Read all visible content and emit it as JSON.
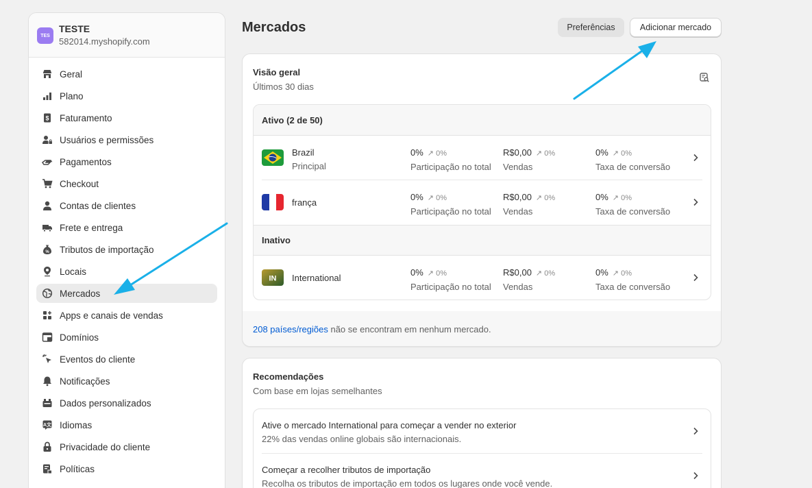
{
  "store": {
    "avatar": "TES",
    "name": "TESTE",
    "url": "582014.myshopify.com"
  },
  "sidebar": {
    "items": [
      {
        "label": "Geral",
        "icon": "store-icon"
      },
      {
        "label": "Plano",
        "icon": "plan-icon"
      },
      {
        "label": "Faturamento",
        "icon": "billing-icon"
      },
      {
        "label": "Usuários e permissões",
        "icon": "users-icon"
      },
      {
        "label": "Pagamentos",
        "icon": "payments-icon"
      },
      {
        "label": "Checkout",
        "icon": "cart-icon"
      },
      {
        "label": "Contas de clientes",
        "icon": "person-icon"
      },
      {
        "label": "Frete e entrega",
        "icon": "truck-icon"
      },
      {
        "label": "Tributos de importação",
        "icon": "duties-icon"
      },
      {
        "label": "Locais",
        "icon": "location-icon"
      },
      {
        "label": "Mercados",
        "icon": "globe-icon",
        "active": true
      },
      {
        "label": "Apps e canais de vendas",
        "icon": "apps-icon"
      },
      {
        "label": "Domínios",
        "icon": "domain-icon"
      },
      {
        "label": "Eventos do cliente",
        "icon": "cursor-icon"
      },
      {
        "label": "Notificações",
        "icon": "bell-icon"
      },
      {
        "label": "Dados personalizados",
        "icon": "data-icon"
      },
      {
        "label": "Idiomas",
        "icon": "language-icon"
      },
      {
        "label": "Privacidade do cliente",
        "icon": "lock-icon"
      },
      {
        "label": "Políticas",
        "icon": "policy-icon"
      }
    ]
  },
  "header": {
    "title": "Mercados",
    "preferences_label": "Preferências",
    "add_market_label": "Adicionar mercado"
  },
  "overview": {
    "title": "Visão geral",
    "subtitle": "Últimos 30 dias",
    "active_heading": "Ativo (2 de 50)",
    "inactive_heading": "Inativo",
    "markets": [
      {
        "name": "Brazil",
        "sub": "Principal",
        "flag": "brazil-flag-icon",
        "share": "0%",
        "share_delta": "0%",
        "share_label": "Participação no total",
        "sales": "R$0,00",
        "sales_delta": "0%",
        "sales_label": "Vendas",
        "conv": "0%",
        "conv_delta": "0%",
        "conv_label": "Taxa de conversão"
      },
      {
        "name": "frança",
        "sub": "",
        "flag": "france-flag-icon",
        "share": "0%",
        "share_delta": "0%",
        "share_label": "Participação no total",
        "sales": "R$0,00",
        "sales_delta": "0%",
        "sales_label": "Vendas",
        "conv": "0%",
        "conv_delta": "0%",
        "conv_label": "Taxa de conversão"
      },
      {
        "name": "International",
        "sub": "",
        "flag": "international-badge-icon",
        "badge": "IN",
        "share": "0%",
        "share_delta": "0%",
        "share_label": "Participação no total",
        "sales": "R$0,00",
        "sales_delta": "0%",
        "sales_label": "Vendas",
        "conv": "0%",
        "conv_delta": "0%",
        "conv_label": "Taxa de conversão"
      }
    ],
    "footer_link": "208 países/regiões",
    "footer_text": " não se encontram em nenhum mercado."
  },
  "recommendations": {
    "title": "Recomendações",
    "subtitle": "Com base em lojas semelhantes",
    "items": [
      {
        "title": "Ative o mercado International para começar a vender no exterior",
        "desc": "22% das vendas online globais são internacionais."
      },
      {
        "title": "Começar a recolher tributos de importação",
        "desc": "Recolha os tributos de importação em todos os lugares onde você vende."
      }
    ]
  },
  "colors": {
    "accent_link": "#005bd3",
    "annotation_arrow": "#1ab0e8",
    "avatar": "#9b7cf1"
  }
}
